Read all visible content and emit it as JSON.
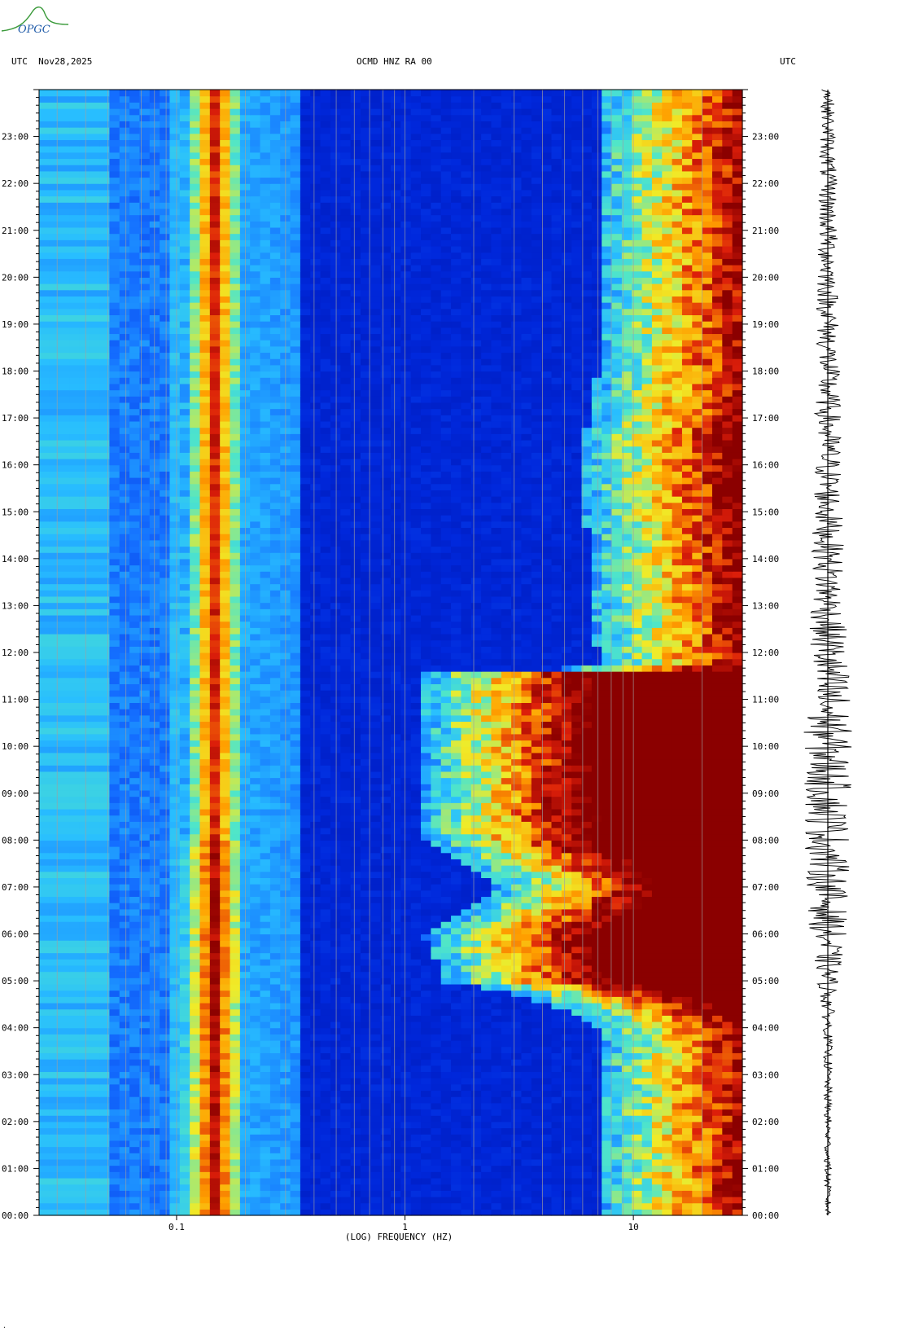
{
  "header": {
    "left_label": "UTC",
    "date": "Nov28,2025",
    "station": "OCMD HNZ RA 00",
    "right_label": "UTC"
  },
  "logo_text": "OPGC",
  "colors": {
    "background": "#ffffff",
    "deep_blue": "#0018c8",
    "cyan": "#2fa8ff",
    "yellow": "#ffd820",
    "red": "#cc1010",
    "dark_red": "#8b0000",
    "trace": "#000000",
    "gridline": "#a0a0a0"
  },
  "chart_data": {
    "type": "heatmap",
    "title": "",
    "xlabel": "(LOG) FREQUENCY (HZ)",
    "ylabel": "",
    "x_scale": "log",
    "xlim": [
      0.025,
      30
    ],
    "x_ticks": [
      {
        "value": 0.1,
        "label": "0.1"
      },
      {
        "value": 1,
        "label": "1"
      },
      {
        "value": 10,
        "label": "10"
      }
    ],
    "x_gridlines": [
      0.03,
      0.04,
      0.05,
      0.06,
      0.07,
      0.08,
      0.09,
      0.1,
      0.2,
      0.3,
      0.4,
      0.5,
      0.6,
      0.7,
      0.8,
      0.9,
      1,
      2,
      3,
      4,
      5,
      6,
      7,
      8,
      9,
      10,
      20
    ],
    "y_range_hours": [
      0,
      24
    ],
    "y_ticks": [
      "00:00",
      "01:00",
      "02:00",
      "03:00",
      "04:00",
      "05:00",
      "06:00",
      "07:00",
      "08:00",
      "09:00",
      "10:00",
      "11:00",
      "12:00",
      "13:00",
      "14:00",
      "15:00",
      "16:00",
      "17:00",
      "18:00",
      "19:00",
      "20:00",
      "21:00",
      "22:00",
      "23:00"
    ],
    "y_tick_hours": [
      0,
      1,
      2,
      3,
      4,
      5,
      6,
      7,
      8,
      9,
      10,
      11,
      12,
      13,
      14,
      15,
      16,
      17,
      18,
      19,
      20,
      21,
      22,
      23
    ],
    "microseism_band_hz": [
      0.12,
      0.18
    ],
    "noise_onset_hz_by_hour": [
      [
        0,
        7
      ],
      [
        4,
        7
      ],
      [
        5,
        1.5
      ],
      [
        6,
        1.2
      ],
      [
        7,
        2.5
      ],
      [
        8,
        1.2
      ],
      [
        11.6,
        1.2
      ],
      [
        11.7,
        7
      ],
      [
        16.5,
        5.8
      ],
      [
        17,
        6.5
      ],
      [
        18,
        7
      ],
      [
        24,
        7
      ]
    ],
    "seismogram_amplitude_by_hour": [
      [
        0,
        0.1
      ],
      [
        4,
        0.15
      ],
      [
        5,
        0.35
      ],
      [
        6,
        0.6
      ],
      [
        8,
        0.75
      ],
      [
        11,
        0.8
      ],
      [
        13,
        0.55
      ],
      [
        18,
        0.4
      ],
      [
        22,
        0.3
      ],
      [
        24,
        0.2
      ]
    ]
  }
}
